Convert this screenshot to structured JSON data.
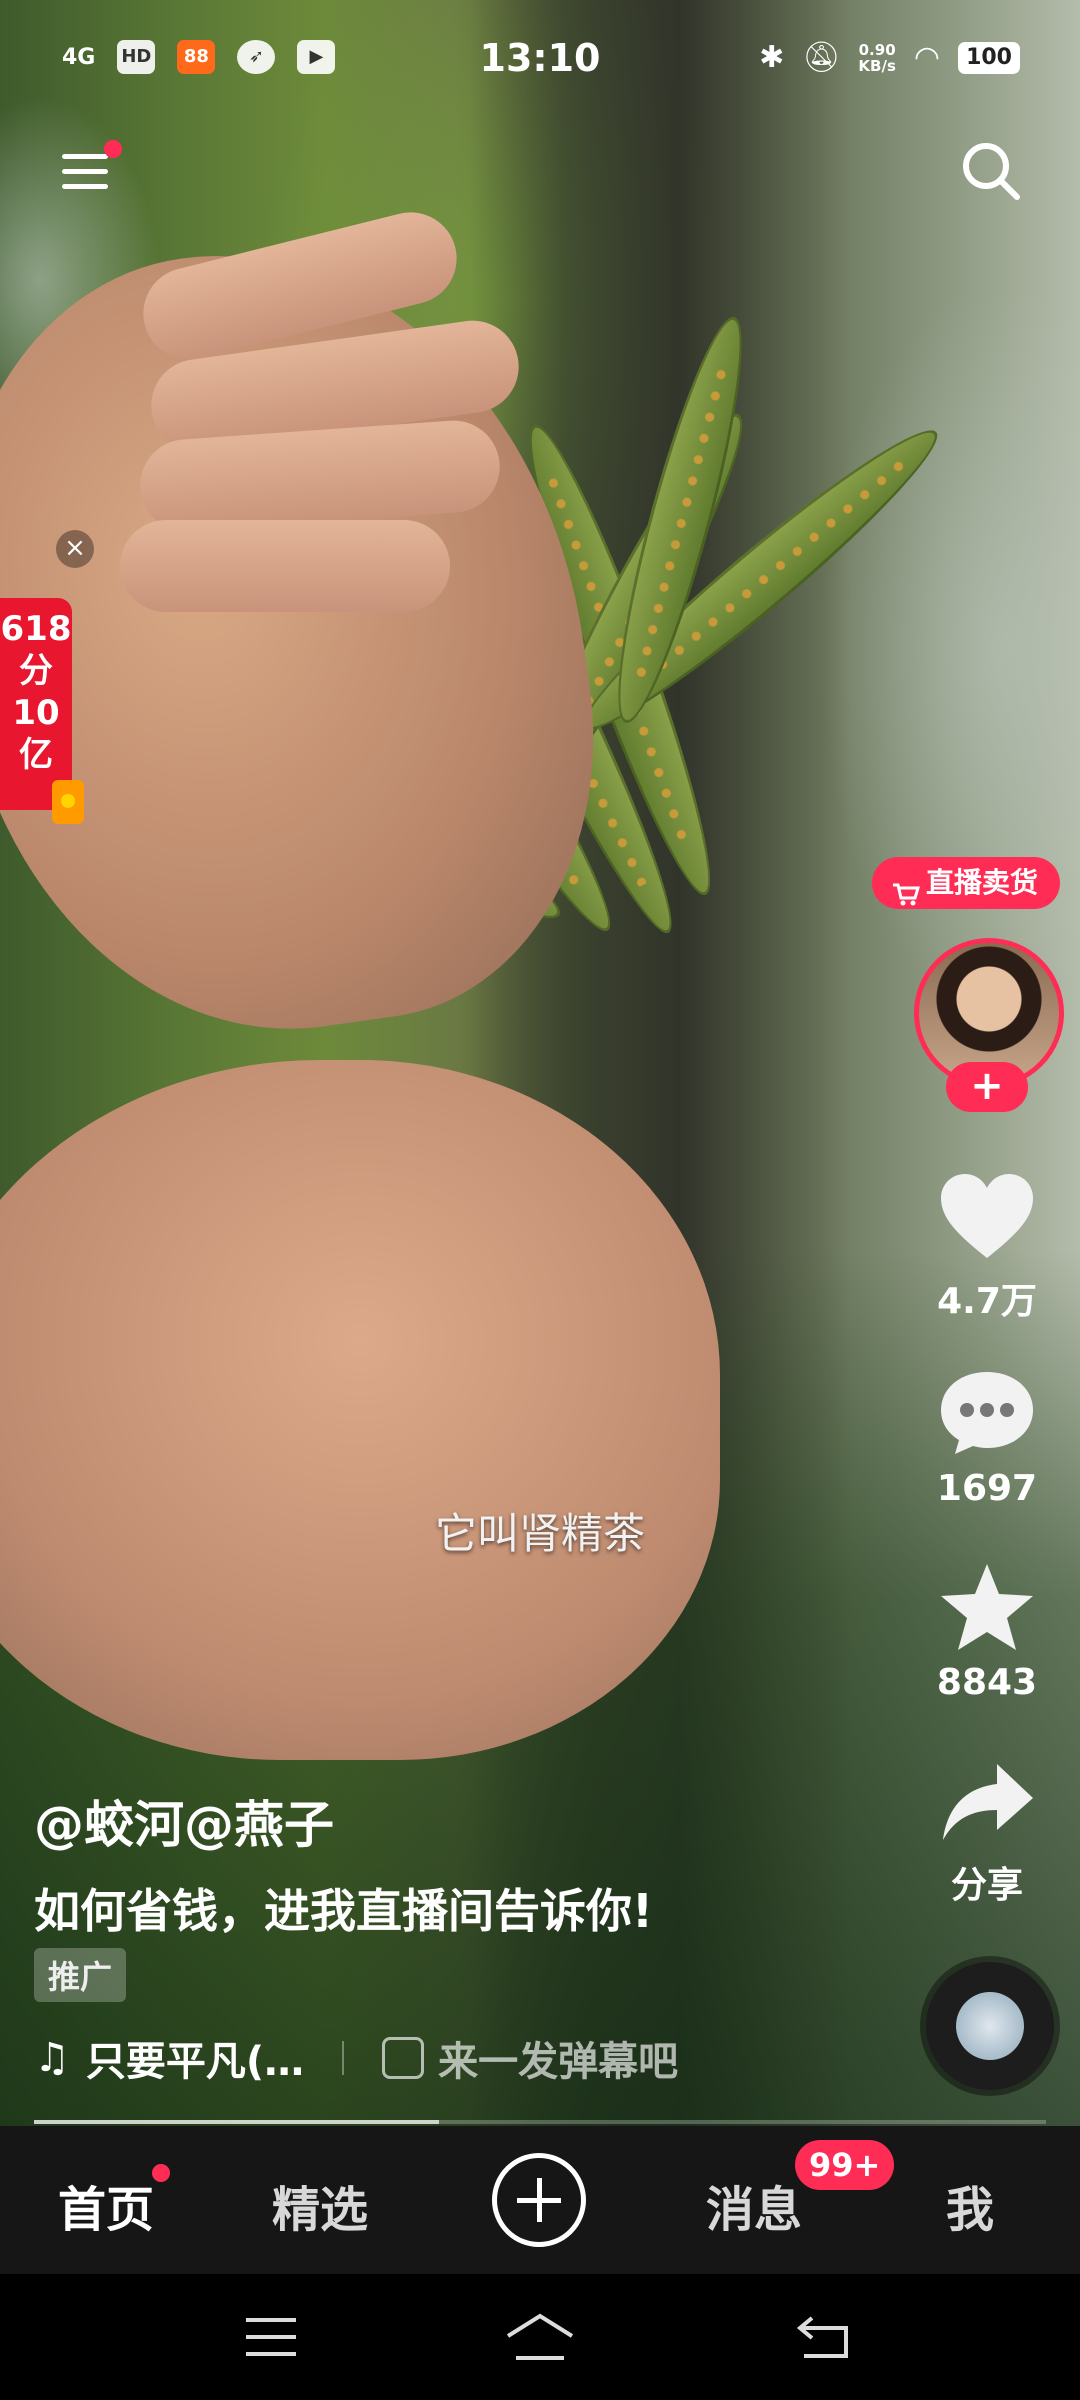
{
  "status_bar": {
    "signal": "4G",
    "hd": "HD",
    "time": "13:10",
    "net_speed_value": "0.90",
    "net_speed_unit": "KB/s",
    "battery": "100"
  },
  "video": {
    "caption": "它叫肾精茶",
    "progress": 0.4
  },
  "promo": {
    "text": "618分10亿",
    "line1": "618",
    "line2": "分",
    "line3": "10",
    "line4": "亿"
  },
  "side": {
    "live_tag": "直播卖货",
    "likes": "4.7万",
    "comments": "1697",
    "favorites": "8843",
    "share": "分享"
  },
  "info": {
    "author": "@蛟河@燕子",
    "description": "如何省钱，进我直播间告诉你!",
    "ad_label": "推广",
    "music": "只要平凡(…",
    "danmu_placeholder": "来一发弹幕吧"
  },
  "tabbar": {
    "home": "首页",
    "featured": "精选",
    "messages": "消息",
    "messages_badge": "99+",
    "me": "我"
  },
  "colors": {
    "accent": "#ff2d55",
    "tabbar_bg": "#161616"
  }
}
